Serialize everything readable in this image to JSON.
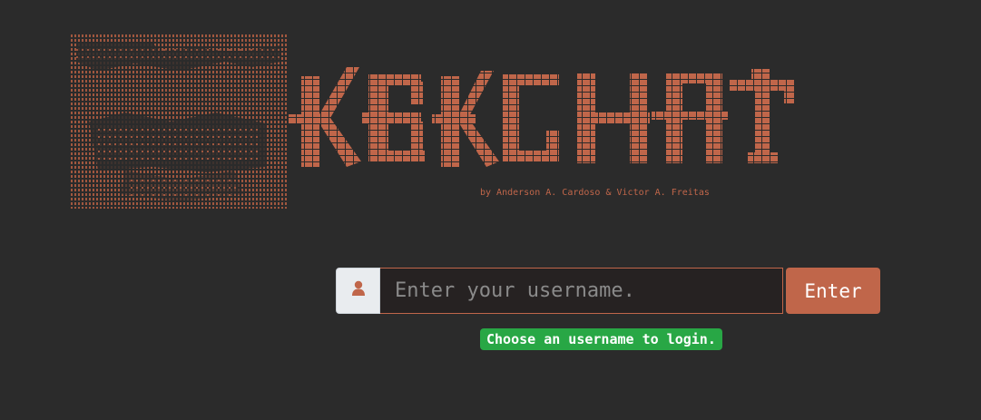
{
  "app": {
    "logo_text": "KEKCHAT",
    "byline": "by Anderson A. Cardoso & Victor A. Freitas"
  },
  "login": {
    "username_placeholder": "Enter your username.",
    "username_value": "",
    "enter_label": "Enter",
    "status_message": "Choose an username to login."
  },
  "icons": {
    "user": "user-icon"
  },
  "colors": {
    "background": "#2b2b2b",
    "accent": "#c0664a",
    "success": "#28a745",
    "input_background": "#262222",
    "addon_background": "#e9ecef"
  }
}
